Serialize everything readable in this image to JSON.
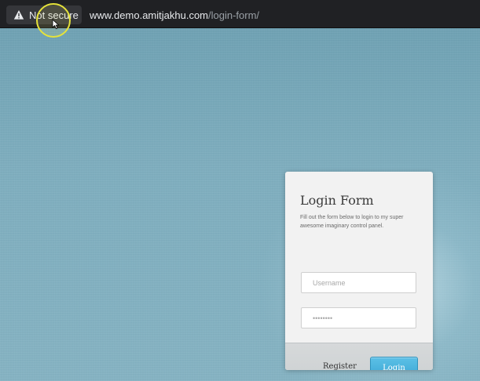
{
  "browser": {
    "security_label": "Not secure",
    "security_icon": "warning-icon",
    "url_host": "www.demo.amitjakhu.com",
    "url_path": "/login-form/"
  },
  "login_form": {
    "title": "Login Form",
    "description": "Fill out the form below to login to my super awesome imaginary control panel.",
    "username": {
      "value": "",
      "placeholder": "Username"
    },
    "password": {
      "value": "",
      "placeholder": "••••••••"
    },
    "register_label": "Register",
    "login_label": "Login"
  },
  "colors": {
    "page_background": "#7eaebf",
    "login_button": "#3aa6d4",
    "chrome_bar": "#202124",
    "cursor_highlight": "#e6e33a"
  }
}
